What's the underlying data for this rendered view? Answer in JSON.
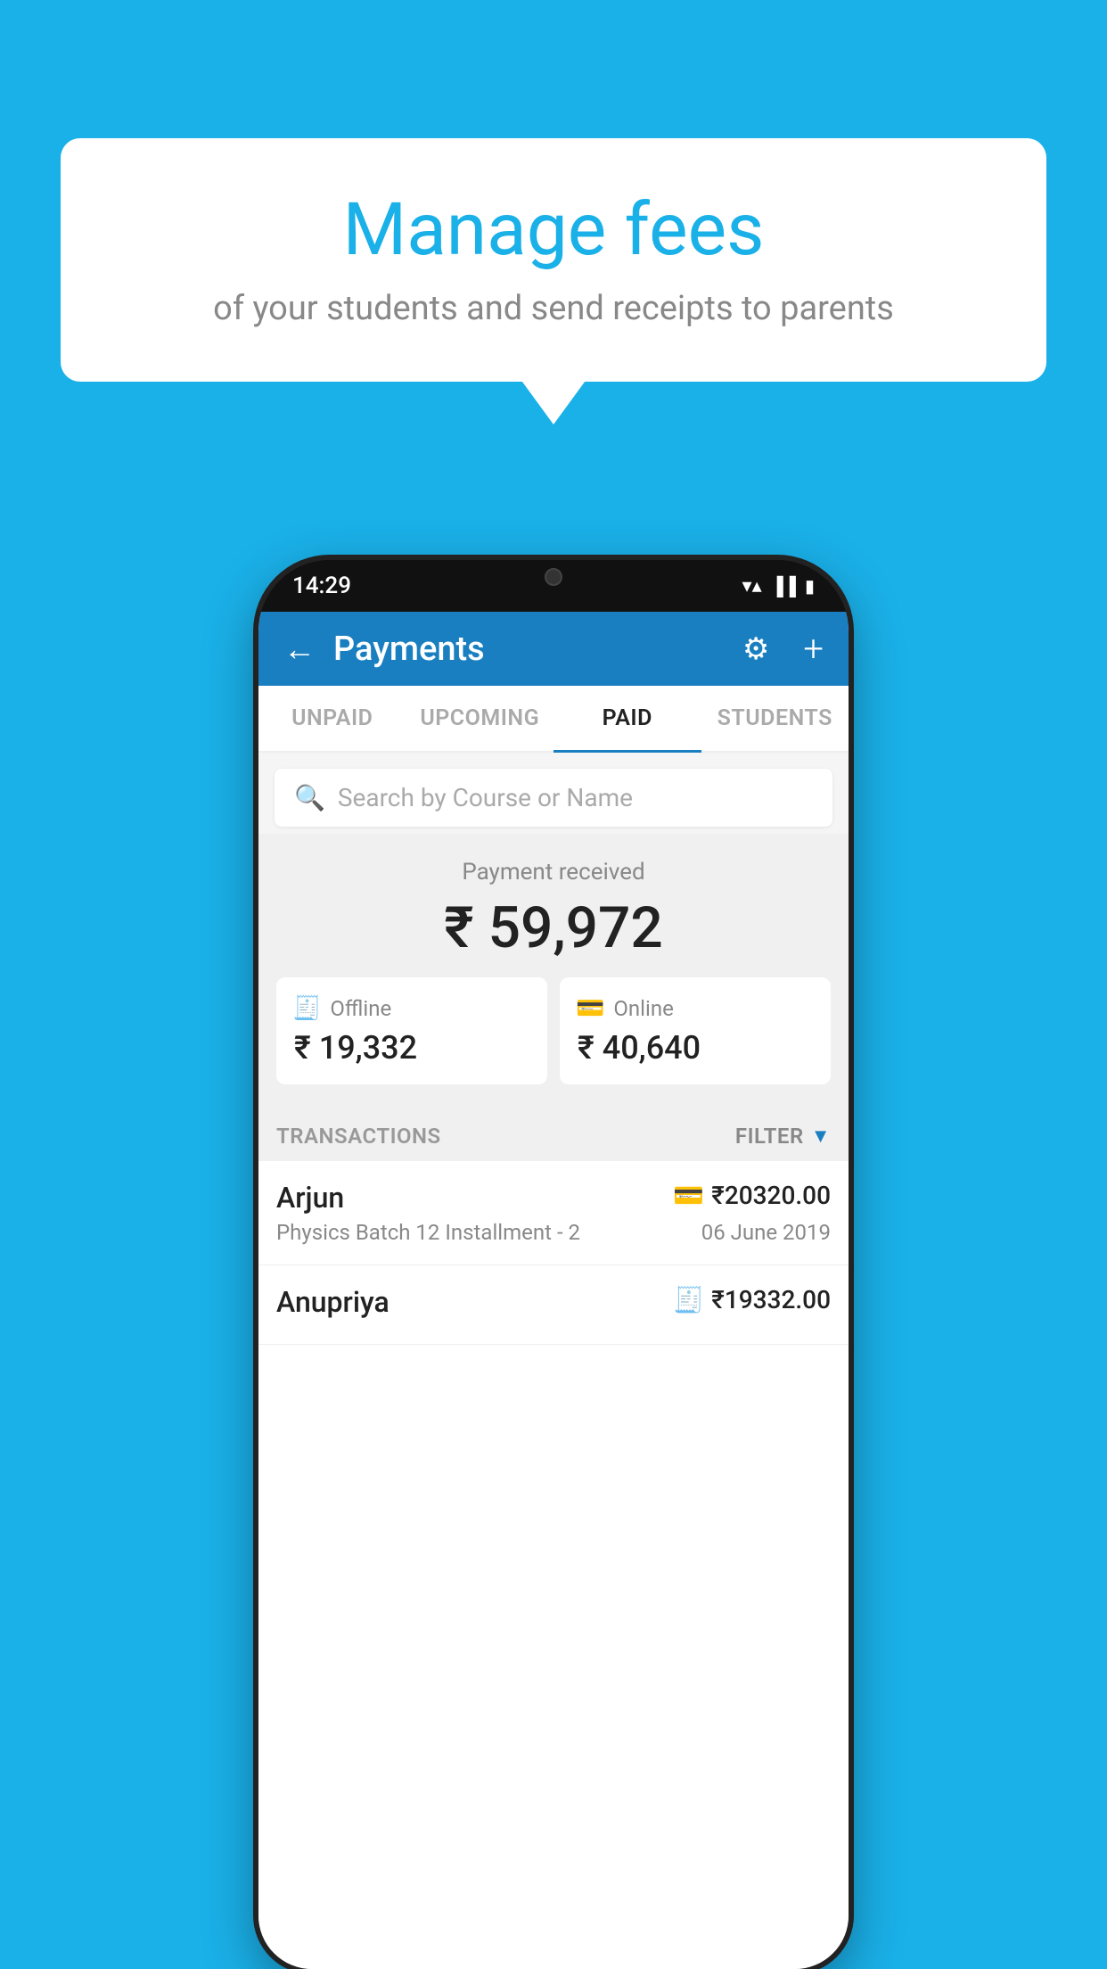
{
  "background_color": "#1ab0e8",
  "bubble": {
    "title": "Manage fees",
    "subtitle": "of your students and send receipts to parents"
  },
  "phone": {
    "status_bar": {
      "time": "14:29",
      "wifi": "▼",
      "signal": "▲",
      "battery": "▮"
    },
    "header": {
      "title": "Payments",
      "back_label": "←",
      "gear_label": "⚙",
      "plus_label": "+"
    },
    "tabs": [
      {
        "label": "UNPAID",
        "active": false
      },
      {
        "label": "UPCOMING",
        "active": false
      },
      {
        "label": "PAID",
        "active": true
      },
      {
        "label": "STUDENTS",
        "active": false
      }
    ],
    "search": {
      "placeholder": "Search by Course or Name"
    },
    "payment_summary": {
      "label": "Payment received",
      "total_amount": "₹ 59,972",
      "offline": {
        "label": "Offline",
        "amount": "₹ 19,332"
      },
      "online": {
        "label": "Online",
        "amount": "₹ 40,640"
      }
    },
    "transactions": {
      "header_label": "TRANSACTIONS",
      "filter_label": "FILTER",
      "items": [
        {
          "name": "Arjun",
          "course": "Physics Batch 12 Installment - 2",
          "amount": "₹20320.00",
          "date": "06 June 2019",
          "payment_type": "online"
        },
        {
          "name": "Anupriya",
          "course": "",
          "amount": "₹19332.00",
          "date": "",
          "payment_type": "offline"
        }
      ]
    }
  }
}
